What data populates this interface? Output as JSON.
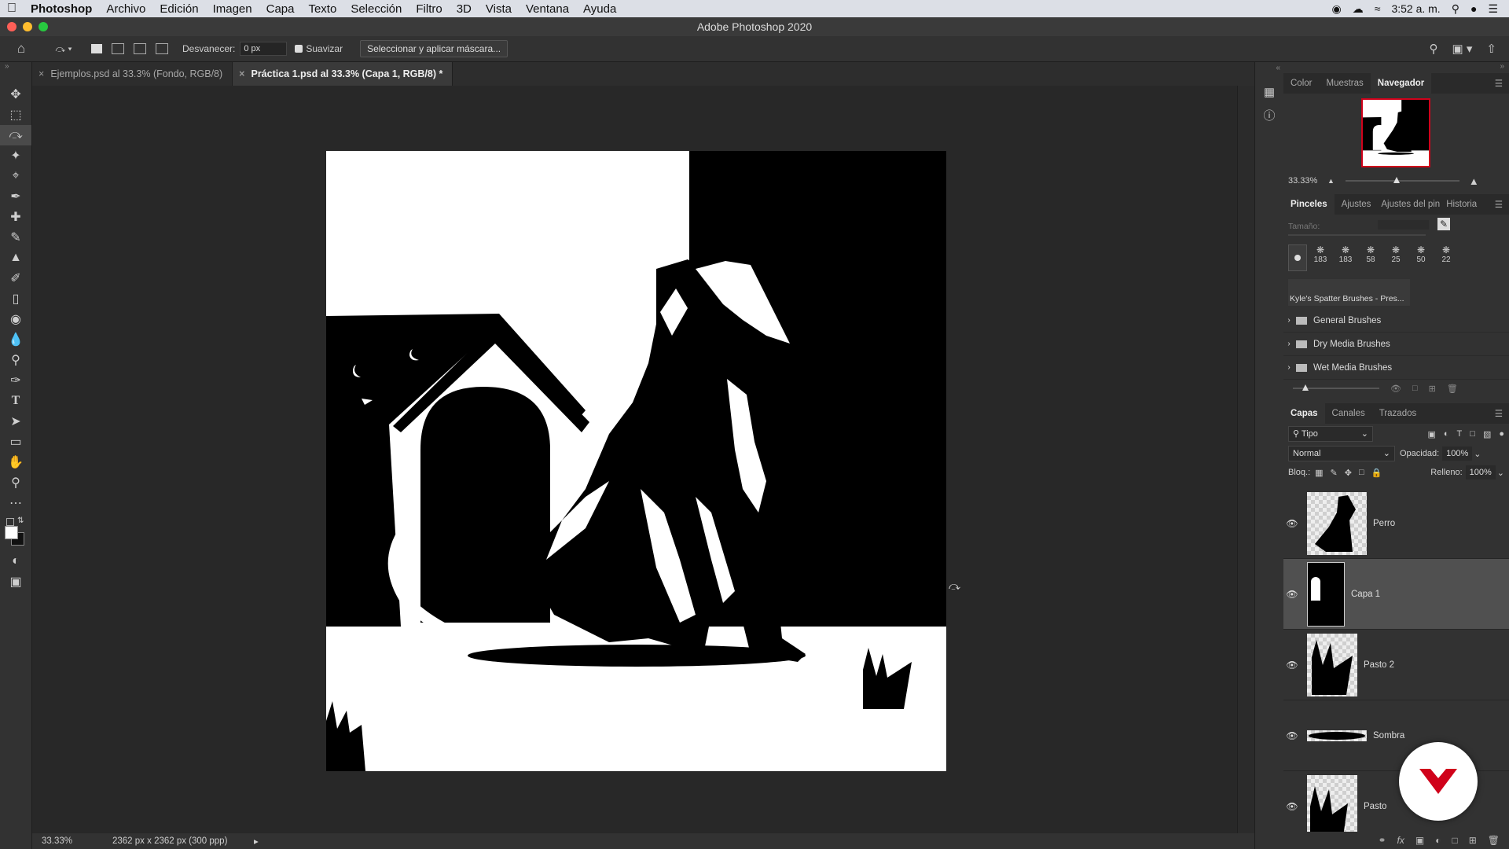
{
  "menubar": {
    "app": "Photoshop",
    "items": [
      "Archivo",
      "Edición",
      "Imagen",
      "Capa",
      "Texto",
      "Selección",
      "Filtro",
      "3D",
      "Vista",
      "Ventana",
      "Ayuda"
    ],
    "clock": "3:52 a. m."
  },
  "window": {
    "title": "Adobe Photoshop 2020"
  },
  "options": {
    "feather_label": "Desvanecer:",
    "feather_value": "0 px",
    "smooth_label": "Suavizar",
    "mask_button": "Seleccionar y aplicar máscara..."
  },
  "tabs": [
    {
      "label": "Ejemplos.psd al 33.3% (Fondo, RGB/8)"
    },
    {
      "label": "Práctica 1.psd al 33.3% (Capa 1, RGB/8) *"
    }
  ],
  "status": {
    "zoom": "33.33%",
    "doc_size": "2362 px x 2362 px (300 ppp)"
  },
  "navigator": {
    "tabs": [
      "Color",
      "Muestras",
      "Navegador"
    ],
    "zoom": "33.33%",
    "zoom_fraction": 0.45
  },
  "brushes": {
    "tabs": [
      "Pinceles",
      "Ajustes",
      "Ajustes del pin",
      "Historia"
    ],
    "size_label": "Tamaño:",
    "presets": [
      "183",
      "183",
      "58",
      "25",
      "50",
      "22"
    ],
    "recent_label": "Kyle's Spatter Brushes - Pres...",
    "folders": [
      "General Brushes",
      "Dry Media Brushes",
      "Wet Media Brushes"
    ]
  },
  "layers": {
    "tabs": [
      "Capas",
      "Canales",
      "Trazados"
    ],
    "filter": "Tipo",
    "blend_mode": "Normal",
    "opacity_label": "Opacidad:",
    "opacity": "100%",
    "lock_label": "Bloq.:",
    "fill_label": "Relleno:",
    "fill": "100%",
    "items": [
      {
        "name": "Perro",
        "selected": false
      },
      {
        "name": "Capa 1",
        "selected": true
      },
      {
        "name": "Pasto 2",
        "selected": false
      },
      {
        "name": "Sombra",
        "selected": false
      },
      {
        "name": "Pasto",
        "selected": false
      }
    ]
  },
  "colors": {
    "accent_red": "#d0021b",
    "panel": "#323232"
  }
}
